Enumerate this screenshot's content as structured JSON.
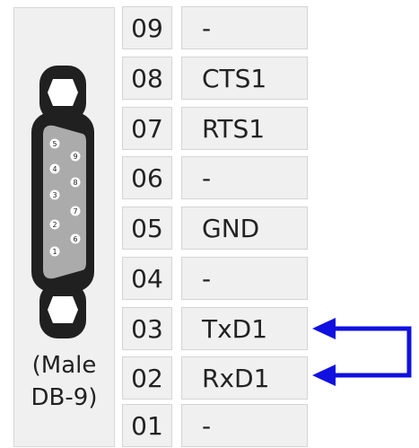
{
  "connector": {
    "caption_line1": "(Male",
    "caption_line2": "DB-9)",
    "pin_labels": {
      "p1": "1",
      "p2": "2",
      "p3": "3",
      "p4": "4",
      "p5": "5",
      "p6": "6",
      "p7": "7",
      "p8": "8",
      "p9": "9"
    }
  },
  "pins": [
    {
      "number": "09",
      "signal": "-"
    },
    {
      "number": "08",
      "signal": "CTS1"
    },
    {
      "number": "07",
      "signal": "RTS1"
    },
    {
      "number": "06",
      "signal": "-"
    },
    {
      "number": "05",
      "signal": "GND"
    },
    {
      "number": "04",
      "signal": "-"
    },
    {
      "number": "03",
      "signal": "TxD1"
    },
    {
      "number": "02",
      "signal": "RxD1"
    },
    {
      "number": "01",
      "signal": "-"
    }
  ],
  "colors": {
    "loopback_arrow": "#1010e0",
    "cell_bg": "#f0f0f0",
    "connector_body": "#202020"
  }
}
